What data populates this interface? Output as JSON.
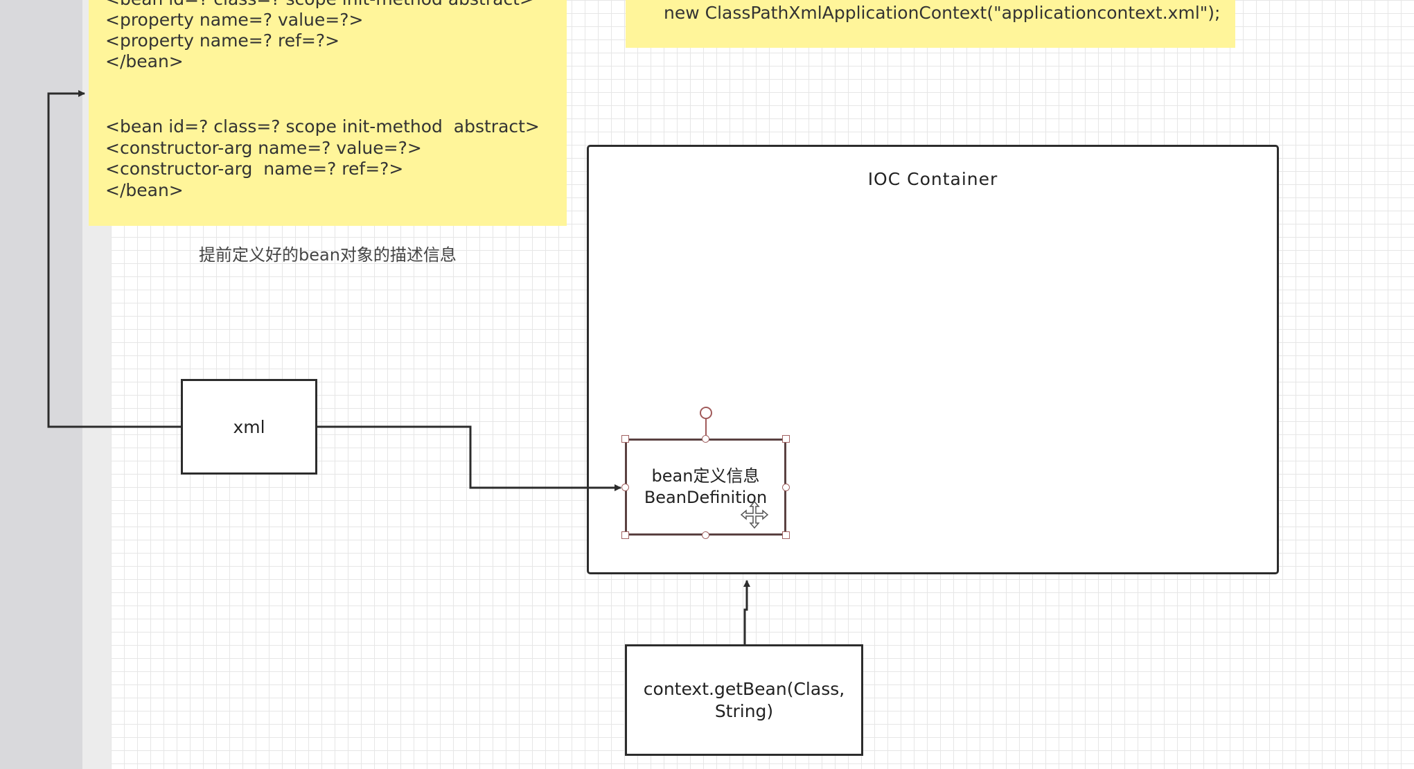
{
  "xml_note": {
    "lines": [
      "<bean id=? class=? scope init-method abstract>",
      "<property name=? value=?>",
      "<property name=? ref=?>",
      "</bean>",
      "<bean id=? class=? scope init-method  abstract>",
      "<constructor-arg name=? value=?>",
      "<constructor-arg  name=? ref=?>",
      "</bean>"
    ]
  },
  "code_note": {
    "text": "new ClassPathXmlApplicationContext(\"applicationcontext.xml\");"
  },
  "caption": "提前定义好的bean对象的描述信息",
  "xml_box": {
    "label": "xml"
  },
  "container": {
    "title": "IOC  Container"
  },
  "bean_definition": {
    "line1": "bean定义信息",
    "line2": "BeanDefinition"
  },
  "getbean_box": {
    "line1": "context.getBean(Class,",
    "line2": "String)"
  },
  "colors": {
    "note_yellow": "#fff59a",
    "stroke": "#2c2c2c",
    "selection": "#a05a5a"
  }
}
